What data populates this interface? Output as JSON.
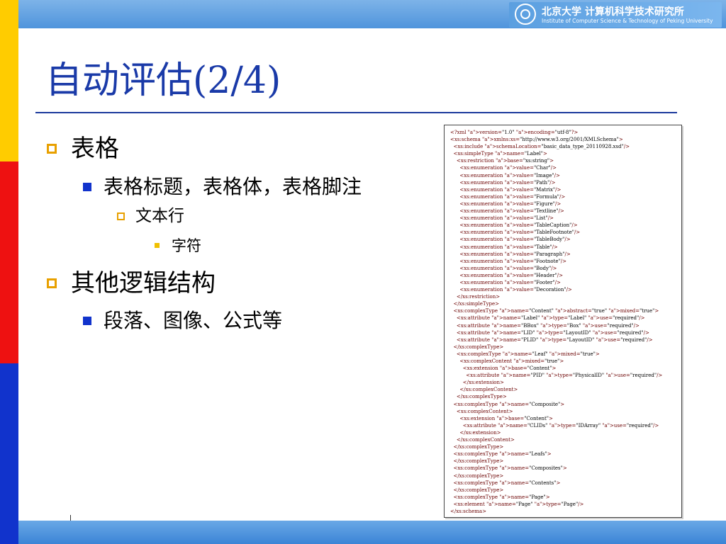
{
  "header": {
    "logo_cn": "北京大学 计算机科学技术研究所",
    "logo_en": "Institute of Computer Science & Technology of Peking University",
    "seal_icon": "university-seal-icon"
  },
  "slide": {
    "title": "自动评估(2/4)",
    "bullets": [
      {
        "level": 1,
        "text": "表格"
      },
      {
        "level": 2,
        "text": "表格标题，表格体，表格脚注"
      },
      {
        "level": 3,
        "text": "文本行"
      },
      {
        "level": 4,
        "text": "字符"
      },
      {
        "level": 1,
        "text": "其他逻辑结构"
      },
      {
        "level": 2,
        "text": "段落、图像、公式等"
      }
    ]
  },
  "colors": {
    "title": "#1a3aa8",
    "stripe_yellow": "#ffcc00",
    "stripe_red": "#ee1111",
    "stripe_blue": "#1133cc",
    "xml_tag": "#6b0000",
    "xml_attr": "#c00000"
  },
  "xml_lines": [
    "<?xml version=\"1.0\" encoding=\"utf-8\"?>",
    "<xs:schema xmlns:xs=\"http://www.w3.org/2001/XMLSchema\">",
    "  <xs:include schemaLocation=\"basic_data_type_20110928.xsd\"/>",
    "  <xs:simpleType name=\"Label\">",
    "    <xs:restriction base=\"xs:string\">",
    "      <xs:enumeration value=\"Char\"/>",
    "      <xs:enumeration value=\"Image\"/>",
    "      <xs:enumeration value=\"Path\"/>",
    "      <xs:enumeration value=\"Matrix\"/>",
    "      <xs:enumeration value=\"Formula\"/>",
    "      <xs:enumeration value=\"Figure\"/>",
    "      <xs:enumeration value=\"Textline\"/>",
    "      <xs:enumeration value=\"List\"/>",
    "      <xs:enumeration value=\"TableCaption\"/>",
    "      <xs:enumeration value=\"TableFootnote\"/>",
    "      <xs:enumeration value=\"TableBody\"/>",
    "      <xs:enumeration value=\"Table\"/>",
    "      <xs:enumeration value=\"Paragraph\"/>",
    "      <xs:enumeration value=\"Footnote\"/>",
    "      <xs:enumeration value=\"Body\"/>",
    "      <xs:enumeration value=\"Header\"/>",
    "      <xs:enumeration value=\"Footer\"/>",
    "      <xs:enumeration value=\"Decoration\"/>",
    "    </xs:restriction>",
    "  </xs:simpleType>",
    "  <xs:complexType name=\"Content\" abstract=\"true\" mixed=\"true\">",
    "    <xs:attribute name=\"Label\" type=\"Label\" use=\"required\"/>",
    "    <xs:attribute name=\"BBox\" type=\"Box\" use=\"required\"/>",
    "    <xs:attribute name=\"LID\" type=\"LayoutID\" use=\"required\"/>",
    "    <xs:attribute name=\"PLID\" type=\"LayoutID\" use=\"required\"/>",
    "  </xs:complexType>",
    "    <xs:complexType name=\"Leaf\" mixed=\"true\">",
    "      <xs:complexContent mixed=\"true\">",
    "        <xs:extension base=\"Content\">",
    "          <xs:attribute name=\"PID\" type=\"PhysicalID\" use=\"required\"/>",
    "        </xs:extension>",
    "      </xs:complexContent>",
    "    </xs:complexType>",
    "  <xs:complexType name=\"Composite\">",
    "    <xs:complexContent>",
    "      <xs:extension base=\"Content\">",
    "        <xs:attribute name=\"CLIDs\" type=\"IDArray\" use=\"required\"/>",
    "      </xs:extension>",
    "    </xs:complexContent>",
    "  </xs:complexType>",
    "  <xs:complexType name=\"Leafs\">",
    "  </xs:complexType>",
    "  <xs:complexType name=\"Composites\">",
    "  </xs:complexType>",
    "  <xs:complexType name=\"Contents\">",
    "  </xs:complexType>",
    "  <xs:complexType name=\"Page\">",
    "  <xs:element name=\"Page\" type=\"Page\"/>",
    "</xs:schema>"
  ]
}
